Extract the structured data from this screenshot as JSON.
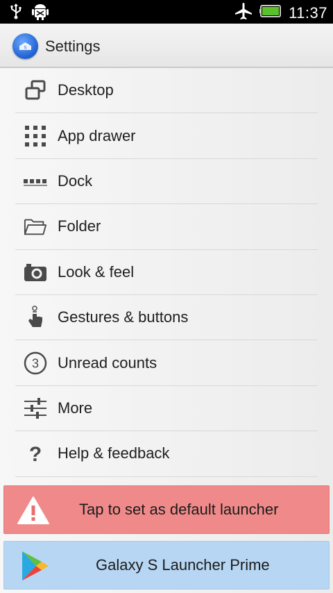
{
  "status_bar": {
    "time": "11:37",
    "icons": [
      "usb-icon",
      "android-debug-icon",
      "airplane-mode-icon",
      "battery-icon"
    ]
  },
  "action_bar": {
    "title": "Settings",
    "icon": "launcher-app-icon"
  },
  "settings_items": [
    {
      "label": "Desktop",
      "icon": "desktop-icon"
    },
    {
      "label": "App drawer",
      "icon": "app-drawer-icon"
    },
    {
      "label": "Dock",
      "icon": "dock-icon"
    },
    {
      "label": "Folder",
      "icon": "folder-icon"
    },
    {
      "label": "Look & feel",
      "icon": "camera-icon"
    },
    {
      "label": "Gestures & buttons",
      "icon": "gesture-icon"
    },
    {
      "label": "Unread counts",
      "icon": "unread-count-icon"
    },
    {
      "label": "More",
      "icon": "sliders-icon"
    },
    {
      "label": "Help & feedback",
      "icon": "help-icon"
    }
  ],
  "banners": {
    "default_launcher": {
      "label": "Tap to set as default launcher",
      "icon": "warning-icon",
      "color": "#f08a8a"
    },
    "prime": {
      "label": "Galaxy S Launcher Prime",
      "icon": "play-store-icon",
      "color": "#b7d6f3"
    }
  },
  "unread_count_badge": "3",
  "help_glyph": "?"
}
